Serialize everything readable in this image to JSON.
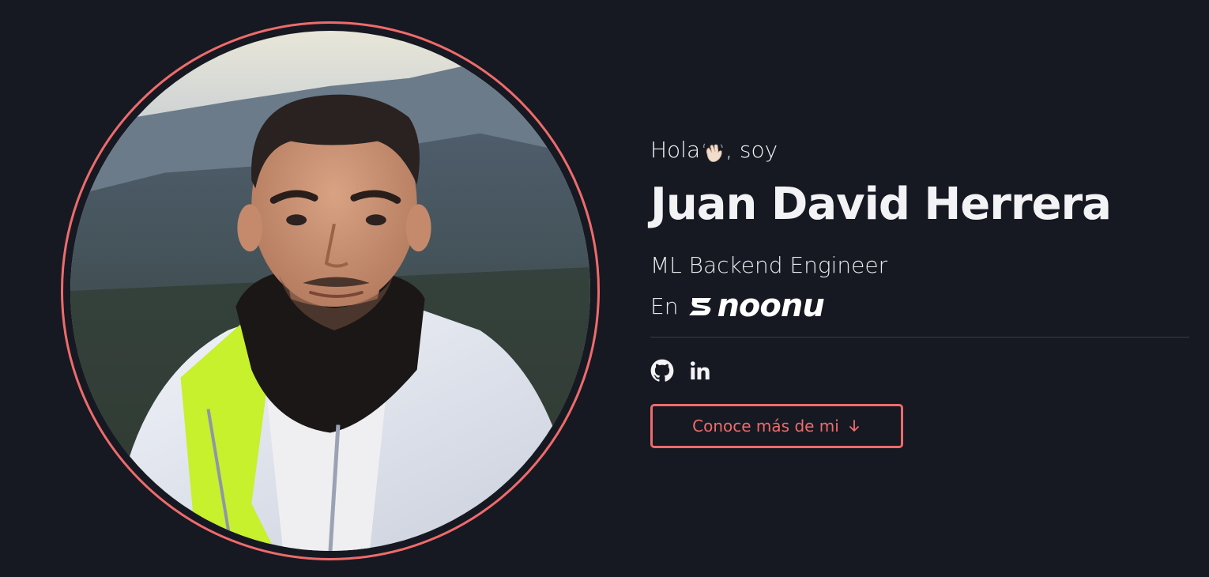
{
  "hero": {
    "greeting_prefix": "Hola",
    "greeting_suffix": ", soy",
    "name": "Juan David Herrera",
    "role": "ML Backend Engineer",
    "company_prefix": "En",
    "company_name": "noonu",
    "company_logo_initial": "S",
    "cta_label": "Conoce más de mi"
  },
  "icons": {
    "greeting": "waving-hand-icon",
    "social": [
      "github-icon",
      "linkedin-icon"
    ],
    "cta": "arrow-down-icon"
  },
  "colors": {
    "background": "#161922",
    "accent": "#ef6b6b",
    "text": "#f3f3f5",
    "divider": "#3b3e47"
  }
}
